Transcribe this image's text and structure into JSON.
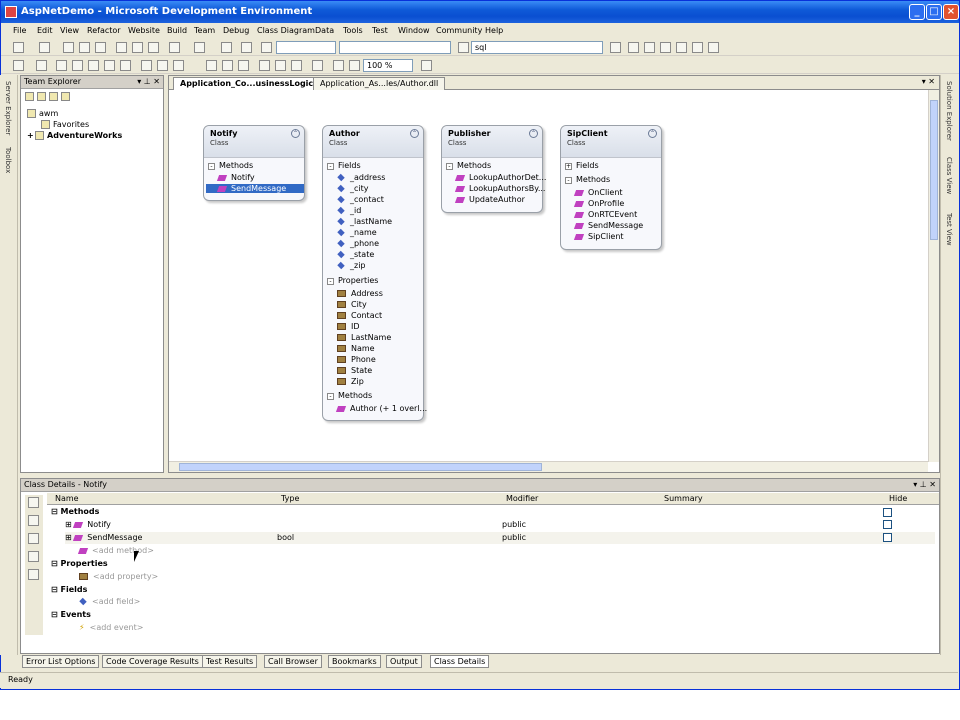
{
  "window": {
    "title": "AspNetDemo - Microsoft Development Environment"
  },
  "menu": [
    "File",
    "Edit",
    "View",
    "Refactor",
    "Website",
    "Build",
    "Team",
    "Debug",
    "Class Diagram",
    "Data",
    "Tools",
    "Test",
    "Window",
    "Community",
    "Help"
  ],
  "toolbar": {
    "find_value": "sql",
    "zoom_value": "100 %"
  },
  "side_left": {
    "server_explorer": "Server Explorer",
    "toolbox": "Toolbox"
  },
  "side_right": {
    "solution_explorer": "Solution Explorer",
    "class_view": "Class View",
    "test_view": "Test View"
  },
  "team_explorer": {
    "title": "Team Explorer",
    "items": [
      "awm",
      "Favorites",
      "AdventureWorks"
    ]
  },
  "document_tabs": [
    "Application_Co...usinessLogic.cd",
    "Application_As...les/Author.dll"
  ],
  "classes": {
    "notify": {
      "name": "Notify",
      "kind": "Class",
      "methods_label": "Methods",
      "methods": [
        "Notify",
        "SendMessage"
      ]
    },
    "author": {
      "name": "Author",
      "kind": "Class",
      "fields_label": "Fields",
      "fields": [
        "_address",
        "_city",
        "_contact",
        "_id",
        "_lastName",
        "_name",
        "_phone",
        "_state",
        "_zip"
      ],
      "properties_label": "Properties",
      "properties": [
        "Address",
        "City",
        "Contact",
        "ID",
        "LastName",
        "Name",
        "Phone",
        "State",
        "Zip"
      ],
      "methods_label": "Methods",
      "methods": [
        "Author (+ 1 overl..."
      ]
    },
    "publisher": {
      "name": "Publisher",
      "kind": "Class",
      "methods_label": "Methods",
      "methods": [
        "LookupAuthorDet...",
        "LookupAuthorsBy...",
        "UpdateAuthor"
      ]
    },
    "sipclient": {
      "name": "SipClient",
      "kind": "Class",
      "fields_label": "Fields",
      "methods_label": "Methods",
      "methods": [
        "OnClient",
        "OnProfile",
        "OnRTCEvent",
        "SendMessage",
        "SipClient"
      ]
    }
  },
  "class_details": {
    "title": "Class Details - Notify",
    "columns": {
      "name": "Name",
      "type": "Type",
      "modifier": "Modifier",
      "summary": "Summary",
      "hide": "Hide"
    },
    "sections": {
      "methods": "Methods",
      "properties": "Properties",
      "fields": "Fields",
      "events": "Events"
    },
    "rows": [
      {
        "name": "Notify",
        "type": "",
        "modifier": "public"
      },
      {
        "name": "SendMessage",
        "type": "bool",
        "modifier": "public"
      }
    ],
    "add_method": "<add method>",
    "add_property": "<add property>",
    "add_field": "<add field>",
    "add_event": "<add event>"
  },
  "bottom_tabs": [
    "Error List Options",
    "Code Coverage Results",
    "Test Results",
    "Call Browser",
    "Bookmarks",
    "Output",
    "Class Details"
  ],
  "status": "Ready"
}
